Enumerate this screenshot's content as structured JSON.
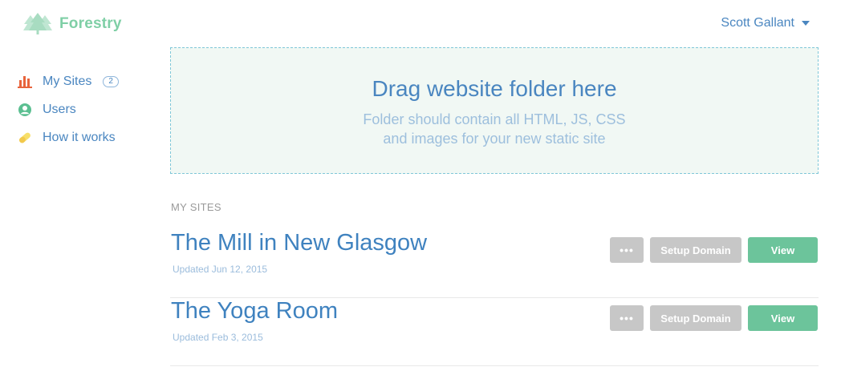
{
  "brand": {
    "name": "Forestry",
    "color": "#7fcfa6"
  },
  "user": {
    "name": "Scott Gallant"
  },
  "sidebar": {
    "items": [
      {
        "label": "My Sites",
        "icon": "bar-chart-icon",
        "badge": "2"
      },
      {
        "label": "Users",
        "icon": "user-circle-icon"
      },
      {
        "label": "How it works",
        "icon": "pill-icon"
      }
    ]
  },
  "dropzone": {
    "title": "Drag website folder here",
    "line1": "Folder should contain all HTML, JS, CSS",
    "line2": "and images for your new static site"
  },
  "sites": {
    "heading": "MY SITES",
    "items": [
      {
        "name": "The Mill in New Glasgow",
        "updated": "Updated Jun 12, 2015"
      },
      {
        "name": "The Yoga Room",
        "updated": "Updated Feb 3, 2015"
      }
    ],
    "actions": {
      "more": "•••",
      "setup_domain": "Setup Domain",
      "view": "View"
    }
  },
  "colors": {
    "accent": "#4a86c0",
    "view_button": "#6cc49b",
    "secondary_button": "#c7c7c7",
    "dropzone_bg": "#f1f8f4"
  }
}
